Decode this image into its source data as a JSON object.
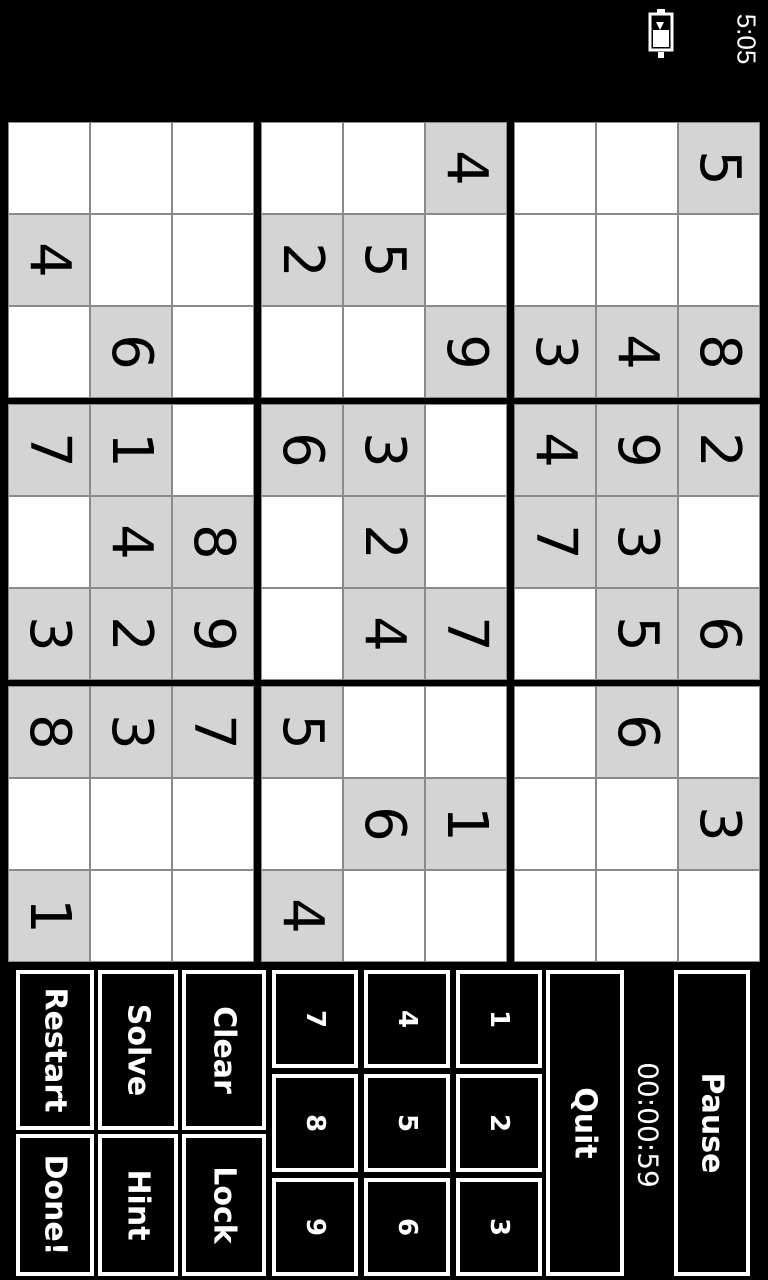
{
  "status_bar": {
    "time": "5:05",
    "battery_icon": "battery-charging-icon"
  },
  "board": {
    "rows": [
      [
        {
          "v": "5",
          "g": true
        },
        {
          "v": "",
          "g": false
        },
        {
          "v": "8",
          "g": true
        },
        {
          "v": "2",
          "g": true
        },
        {
          "v": "",
          "g": false
        },
        {
          "v": "6",
          "g": true
        },
        {
          "v": "",
          "g": false
        },
        {
          "v": "3",
          "g": true
        },
        {
          "v": "",
          "g": false
        }
      ],
      [
        {
          "v": "",
          "g": false
        },
        {
          "v": "",
          "g": false
        },
        {
          "v": "4",
          "g": true
        },
        {
          "v": "9",
          "g": true
        },
        {
          "v": "3",
          "g": true
        },
        {
          "v": "5",
          "g": true
        },
        {
          "v": "6",
          "g": true
        },
        {
          "v": "",
          "g": false
        },
        {
          "v": "",
          "g": false
        }
      ],
      [
        {
          "v": "",
          "g": false
        },
        {
          "v": "",
          "g": false
        },
        {
          "v": "3",
          "g": true
        },
        {
          "v": "4",
          "g": true
        },
        {
          "v": "7",
          "g": true
        },
        {
          "v": "",
          "g": false
        },
        {
          "v": "",
          "g": false
        },
        {
          "v": "",
          "g": false
        },
        {
          "v": "",
          "g": false
        }
      ],
      [
        {
          "v": "4",
          "g": true
        },
        {
          "v": "",
          "g": false
        },
        {
          "v": "9",
          "g": true
        },
        {
          "v": "",
          "g": false
        },
        {
          "v": "",
          "g": false
        },
        {
          "v": "7",
          "g": true
        },
        {
          "v": "",
          "g": false
        },
        {
          "v": "1",
          "g": true
        },
        {
          "v": "",
          "g": false
        }
      ],
      [
        {
          "v": "",
          "g": false
        },
        {
          "v": "5",
          "g": true
        },
        {
          "v": "",
          "g": false
        },
        {
          "v": "3",
          "g": true
        },
        {
          "v": "2",
          "g": true
        },
        {
          "v": "4",
          "g": true
        },
        {
          "v": "",
          "g": false
        },
        {
          "v": "6",
          "g": true
        },
        {
          "v": "",
          "g": false
        }
      ],
      [
        {
          "v": "",
          "g": false
        },
        {
          "v": "2",
          "g": true
        },
        {
          "v": "",
          "g": false
        },
        {
          "v": "6",
          "g": true
        },
        {
          "v": "",
          "g": false
        },
        {
          "v": "",
          "g": false
        },
        {
          "v": "5",
          "g": true
        },
        {
          "v": "",
          "g": false
        },
        {
          "v": "4",
          "g": true
        }
      ],
      [
        {
          "v": "",
          "g": false
        },
        {
          "v": "",
          "g": false
        },
        {
          "v": "",
          "g": false
        },
        {
          "v": "",
          "g": false
        },
        {
          "v": "8",
          "g": true
        },
        {
          "v": "9",
          "g": true
        },
        {
          "v": "7",
          "g": true
        },
        {
          "v": "",
          "g": false
        },
        {
          "v": "",
          "g": false
        }
      ],
      [
        {
          "v": "",
          "g": false
        },
        {
          "v": "",
          "g": false
        },
        {
          "v": "6",
          "g": true
        },
        {
          "v": "1",
          "g": true
        },
        {
          "v": "4",
          "g": true
        },
        {
          "v": "2",
          "g": true
        },
        {
          "v": "3",
          "g": true
        },
        {
          "v": "",
          "g": false
        },
        {
          "v": "",
          "g": false
        }
      ],
      [
        {
          "v": "",
          "g": false
        },
        {
          "v": "4",
          "g": true
        },
        {
          "v": "",
          "g": false
        },
        {
          "v": "7",
          "g": true
        },
        {
          "v": "",
          "g": false
        },
        {
          "v": "3",
          "g": true
        },
        {
          "v": "8",
          "g": true
        },
        {
          "v": "",
          "g": false
        },
        {
          "v": "1",
          "g": true
        }
      ]
    ]
  },
  "controls": {
    "pause": "Pause",
    "timer": "00:00:59",
    "quit": "Quit",
    "keypad": [
      "1",
      "2",
      "3",
      "4",
      "5",
      "6",
      "7",
      "8",
      "9"
    ],
    "clear": "Clear",
    "lock": "Lock",
    "solve": "Solve",
    "hint": "Hint",
    "restart": "Restart",
    "done": "Done!"
  }
}
